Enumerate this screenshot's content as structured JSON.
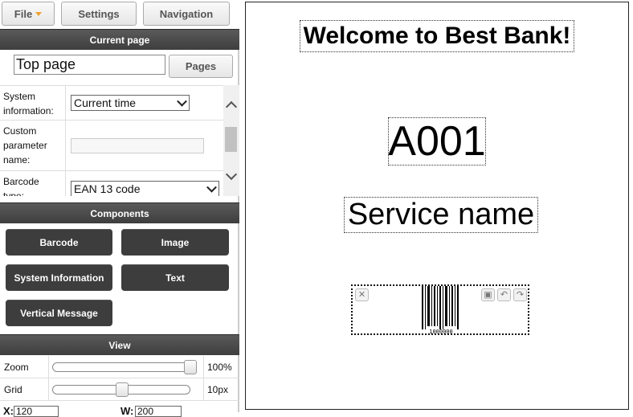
{
  "menu": {
    "file": "File",
    "settings": "Settings",
    "navigation": "Navigation"
  },
  "current_page": {
    "header": "Current page",
    "page_name": "Top page",
    "pages_button": "Pages"
  },
  "properties": {
    "rows": [
      {
        "label": "System information:",
        "value": "Current time"
      },
      {
        "label": "Custom parameter name:",
        "value": ""
      },
      {
        "label": "Barcode type:",
        "value": "EAN 13 code"
      }
    ]
  },
  "components": {
    "header": "Components",
    "buttons": [
      "Barcode",
      "Image",
      "System Information",
      "Text",
      "Vertical Message"
    ]
  },
  "view": {
    "header": "View",
    "zoom_label": "Zoom",
    "zoom_value": "100%",
    "zoom_level": 1.0,
    "grid_label": "Grid",
    "grid_value": "10px",
    "x_label": "X:",
    "x_value": "120",
    "w_label": "W:",
    "w_value": "200"
  },
  "canvas": {
    "title": "Welcome to Best Bank!",
    "number": "A001",
    "service": "Service name",
    "barcode_text": "1000000"
  }
}
